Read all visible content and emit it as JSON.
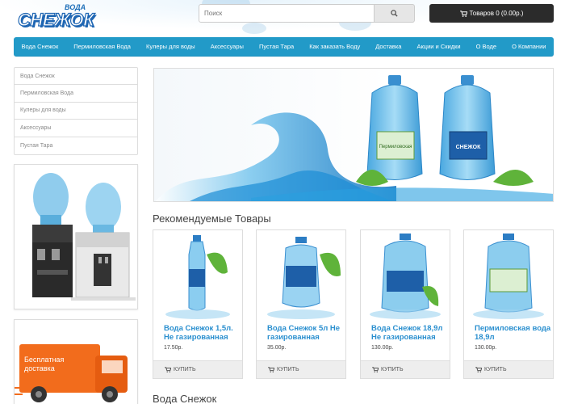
{
  "header": {
    "logo_small": "ВОДА",
    "logo_big": "СНЕЖОК",
    "search_placeholder": "Поиск",
    "cart_label": "Товаров 0 (0.00р.)"
  },
  "nav": [
    "Вода Снежок",
    "Пермиловская Вода",
    "Кулеры для воды",
    "Аксессуары",
    "Пустая Тара",
    "Как заказать Воду",
    "Доставка",
    "Акции и Скидки",
    "О Воде",
    "О Компании"
  ],
  "sidebar": {
    "categories": [
      "Вода Снежок",
      "Пермиловская Вода",
      "Кулеры для воды",
      "Аксессуары",
      "Пустая Тара"
    ],
    "promo_line1": "Бесплатная",
    "promo_line2": "доставка"
  },
  "banner": {
    "bottle1_label": "Пермиловская",
    "bottle2_label": "СНЕЖОК"
  },
  "featured": {
    "title": "Рекомендуемые Товары",
    "buy_label": "КУПИТЬ",
    "products": [
      {
        "name": "Вода Снежок 1,5л. Не газированная",
        "price": "17.50р."
      },
      {
        "name": "Вода Снежок 5л Не газированная",
        "price": "35.00р."
      },
      {
        "name": "Вода Снежок 18,9л Не газированная",
        "price": "130.00р."
      },
      {
        "name": "Пермиловская вода 18,9л",
        "price": "130.00р."
      }
    ]
  },
  "bottom_title": "Вода Снежок",
  "colors": {
    "nav": "#229ac8",
    "link": "#2a8fcf",
    "cart": "#2b2b2b",
    "promo": "#f26c1c"
  }
}
